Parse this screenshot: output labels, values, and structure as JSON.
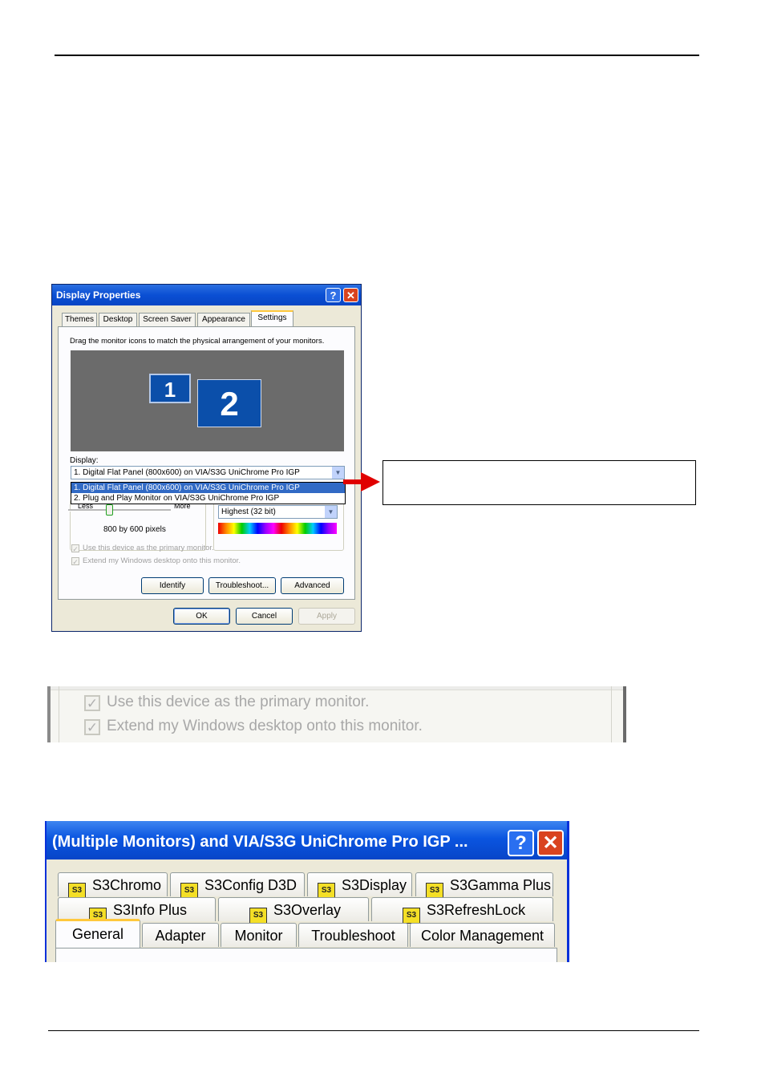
{
  "display_properties": {
    "title": "Display Properties",
    "help_glyph": "?",
    "close_glyph": "✕",
    "tabs": [
      "Themes",
      "Desktop",
      "Screen Saver",
      "Appearance",
      "Settings"
    ],
    "instruction": "Drag the monitor icons to match the physical arrangement of your monitors.",
    "monitor_1": "1",
    "monitor_2": "2",
    "display_label": "Display:",
    "display_value": "1. Digital Flat Panel (800x600) on VIA/S3G UniChrome Pro IGP",
    "dropdown_options": [
      "1. Digital Flat Panel (800x600) on VIA/S3G UniChrome Pro IGP",
      "2. Plug and Play Monitor on VIA/S3G UniChrome Pro IGP"
    ],
    "slider_less": "Less",
    "slider_more": "More",
    "resolution_text": "800 by 600 pixels",
    "color_quality_value": "Highest (32 bit)",
    "checkbox_primary": "Use this device as the primary monitor.",
    "checkbox_extend": "Extend my Windows desktop onto this monitor.",
    "buttons": {
      "identify": "Identify",
      "troubleshoot": "Troubleshoot...",
      "advanced": "Advanced",
      "ok": "OK",
      "cancel": "Cancel",
      "apply": "Apply"
    },
    "arrow_color": "#e00000"
  },
  "zoomed_checkboxes": {
    "primary": "Use this device as the primary monitor.",
    "extend": "Extend my Windows desktop onto this monitor."
  },
  "multiple_monitors_dialog": {
    "title": "(Multiple Monitors) and VIA/S3G UniChrome Pro IGP ...",
    "help_glyph": "?",
    "close_glyph": "✕",
    "icon_text": "S3",
    "tabs_row1": [
      "S3Chromo",
      "S3Config D3D",
      "S3Display",
      "S3Gamma Plus"
    ],
    "tabs_row2": [
      "S3Info Plus",
      "S3Overlay",
      "S3RefreshLock"
    ],
    "tabs_row3": [
      "General",
      "Adapter",
      "Monitor",
      "Troubleshoot",
      "Color Management"
    ],
    "active_tab": "General"
  }
}
